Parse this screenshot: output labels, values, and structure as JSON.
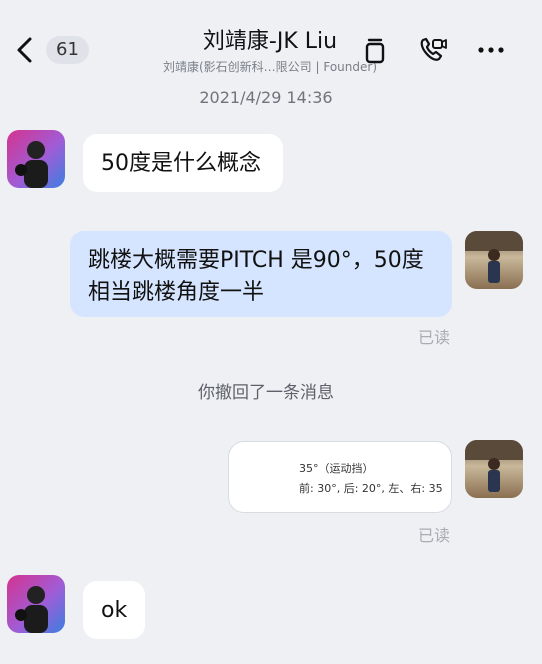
{
  "header": {
    "unread_count": "61",
    "title": "刘靖康-JK Liu",
    "subtitle": "刘靖康(影石创新科…限公司 | Founder)"
  },
  "timestamp": "2021/4/29 14:36",
  "messages": [
    {
      "sender": "other",
      "text": "50度是什么概念"
    },
    {
      "sender": "me",
      "line1": "跳楼大概需要PITCH  是90°，50度",
      "line2": "相当跳楼角度一半",
      "status": "已读"
    },
    {
      "sender": "me",
      "card_line1": "35°（运动挡）",
      "card_line2": "前: 30°, 后: 20°, 左、右: 35",
      "status": "已读"
    },
    {
      "sender": "other",
      "text": "ok"
    }
  ],
  "notice": "你撤回了一条消息",
  "icons": [
    "back-chevron-icon",
    "copy-icon",
    "phone-video-icon",
    "more-icon"
  ],
  "colors": {
    "background": "#eef0f4",
    "outgoing_bubble": "#d5e5ff",
    "incoming_bubble": "#ffffff"
  }
}
